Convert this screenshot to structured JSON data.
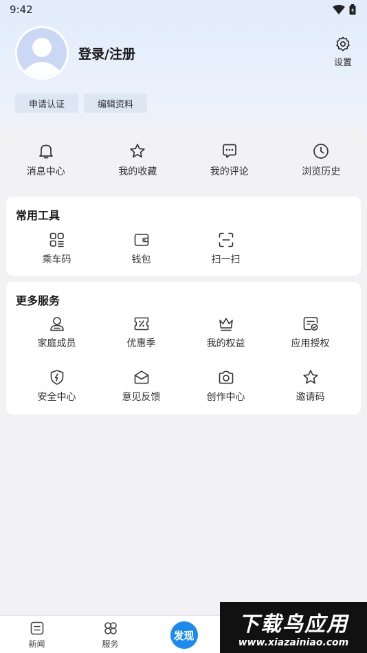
{
  "status_bar": {
    "time": "9:42"
  },
  "profile": {
    "login_text": "登录/注册"
  },
  "settings": {
    "label": "设置"
  },
  "chips": [
    {
      "label": "申请认证"
    },
    {
      "label": "编辑资料"
    }
  ],
  "quick_actions": [
    {
      "label": "消息中心",
      "icon": "bell-icon"
    },
    {
      "label": "我的收藏",
      "icon": "star-icon"
    },
    {
      "label": "我的评论",
      "icon": "comment-icon"
    },
    {
      "label": "浏览历史",
      "icon": "clock-icon"
    }
  ],
  "tools": {
    "title": "常用工具",
    "items": [
      {
        "label": "乘车码",
        "icon": "qr-code-icon"
      },
      {
        "label": "钱包",
        "icon": "wallet-icon"
      },
      {
        "label": "扫一扫",
        "icon": "scan-icon"
      }
    ]
  },
  "services": {
    "title": "更多服务",
    "items": [
      {
        "label": "家庭成员",
        "icon": "person-icon"
      },
      {
        "label": "优惠季",
        "icon": "coupon-icon"
      },
      {
        "label": "我的权益",
        "icon": "crown-icon"
      },
      {
        "label": "应用授权",
        "icon": "authorize-icon"
      },
      {
        "label": "安全中心",
        "icon": "shield-icon"
      },
      {
        "label": "意见反馈",
        "icon": "envelope-icon"
      },
      {
        "label": "创作中心",
        "icon": "camera-icon"
      },
      {
        "label": "邀请码",
        "icon": "star-outline-icon"
      }
    ]
  },
  "bottom_nav": [
    {
      "label": "新闻",
      "icon": "news-icon"
    },
    {
      "label": "服务",
      "icon": "grid-clover-icon"
    },
    {
      "label": "发现",
      "icon": "discover-button"
    }
  ],
  "watermark": {
    "title": "下载鸟应用",
    "url": "www.xiazainiao.com"
  },
  "colors": {
    "accent": "#1a8cf0",
    "header_bg": "#e2ecfb",
    "page_bg": "#f2f2f4"
  }
}
